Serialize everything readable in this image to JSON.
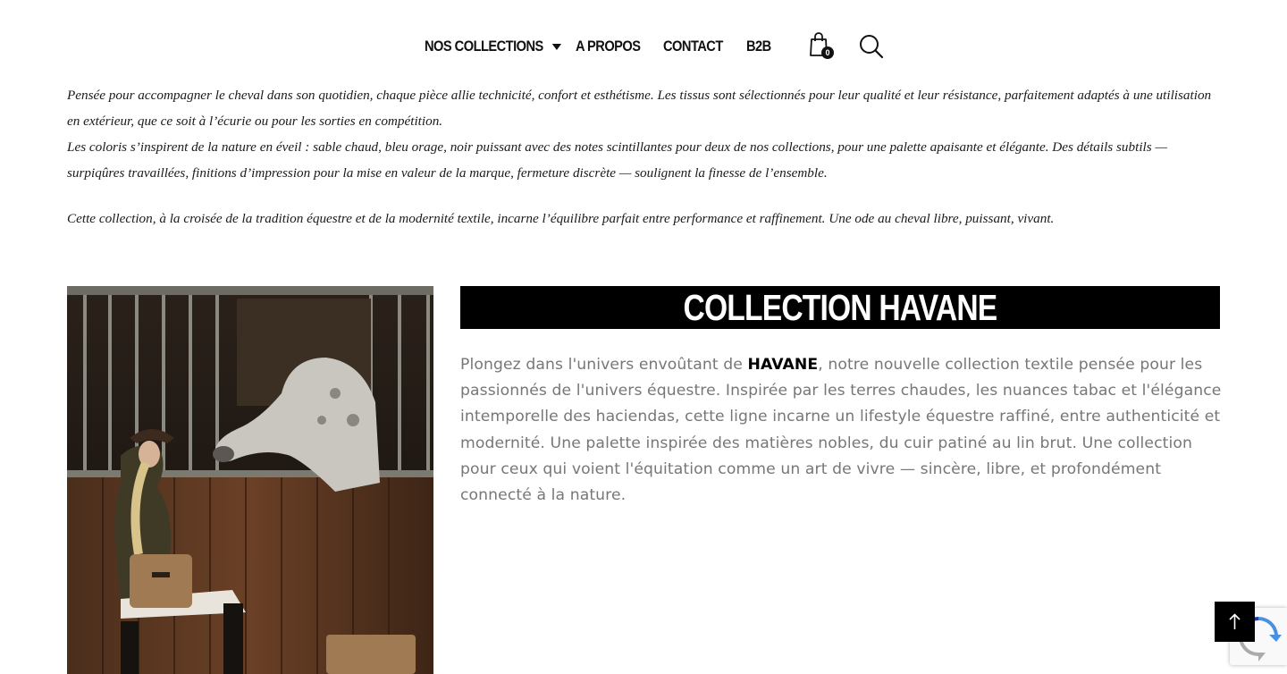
{
  "header": {
    "nav": [
      {
        "label": "NOS COLLECTIONS"
      },
      {
        "label": "A PROPOS"
      },
      {
        "label": "CONTACT"
      },
      {
        "label": "B2B"
      }
    ],
    "cart_count": "0",
    "icons": [
      "cart-icon",
      "search-icon",
      "chevron-down-icon"
    ]
  },
  "intro": {
    "p1": "Pensée pour accompagner le cheval dans son quotidien, chaque pièce allie technicité, confort et esthétisme. Les tissus sont sélectionnés pour leur qualité et leur résistance, parfaitement adaptés à une utilisation en extérieur, que ce soit à l’écurie ou pour les sorties en compétition.",
    "p2": "Les coloris s’inspirent de la nature en éveil : sable chaud, bleu orage, noir puissant avec des notes scintillantes pour deux de nos collections, pour une palette apaisante et élégante. Des détails subtils — surpiqûres travaillées, finitions d’impression pour la mise en valeur de la marque, fermeture discrète — soulignent la finesse de l’ensemble.",
    "p3": "Cette collection, à la croisée de la tradition équestre et de la modernité textile, incarne l’équilibre parfait entre performance et raffinement. Une ode au cheval libre, puissant, vivant."
  },
  "collection": {
    "title": "COLLECTION HAVANE",
    "text_before": "Plongez dans l'univers envoûtant de ",
    "brand": "HAVANE",
    "text_after": ", notre nouvelle collection textile pensée pour les passionnés de l'univers équestre. Inspirée par les terres chaudes, les nuances tabac et l'élégance intemporelle des haciendas, cette ligne incarne un lifestyle équestre raffiné, entre authenticité et modernité. Une palette inspirée des matières nobles, du cuir patiné au lin brut. Une collection pour ceux qui voient l'équitation comme un art de vivre — sincère, libre, et profondément connecté à la nature."
  },
  "colors": {
    "accent": "#000000",
    "body_text": "#777777",
    "background": "#ffffff"
  }
}
